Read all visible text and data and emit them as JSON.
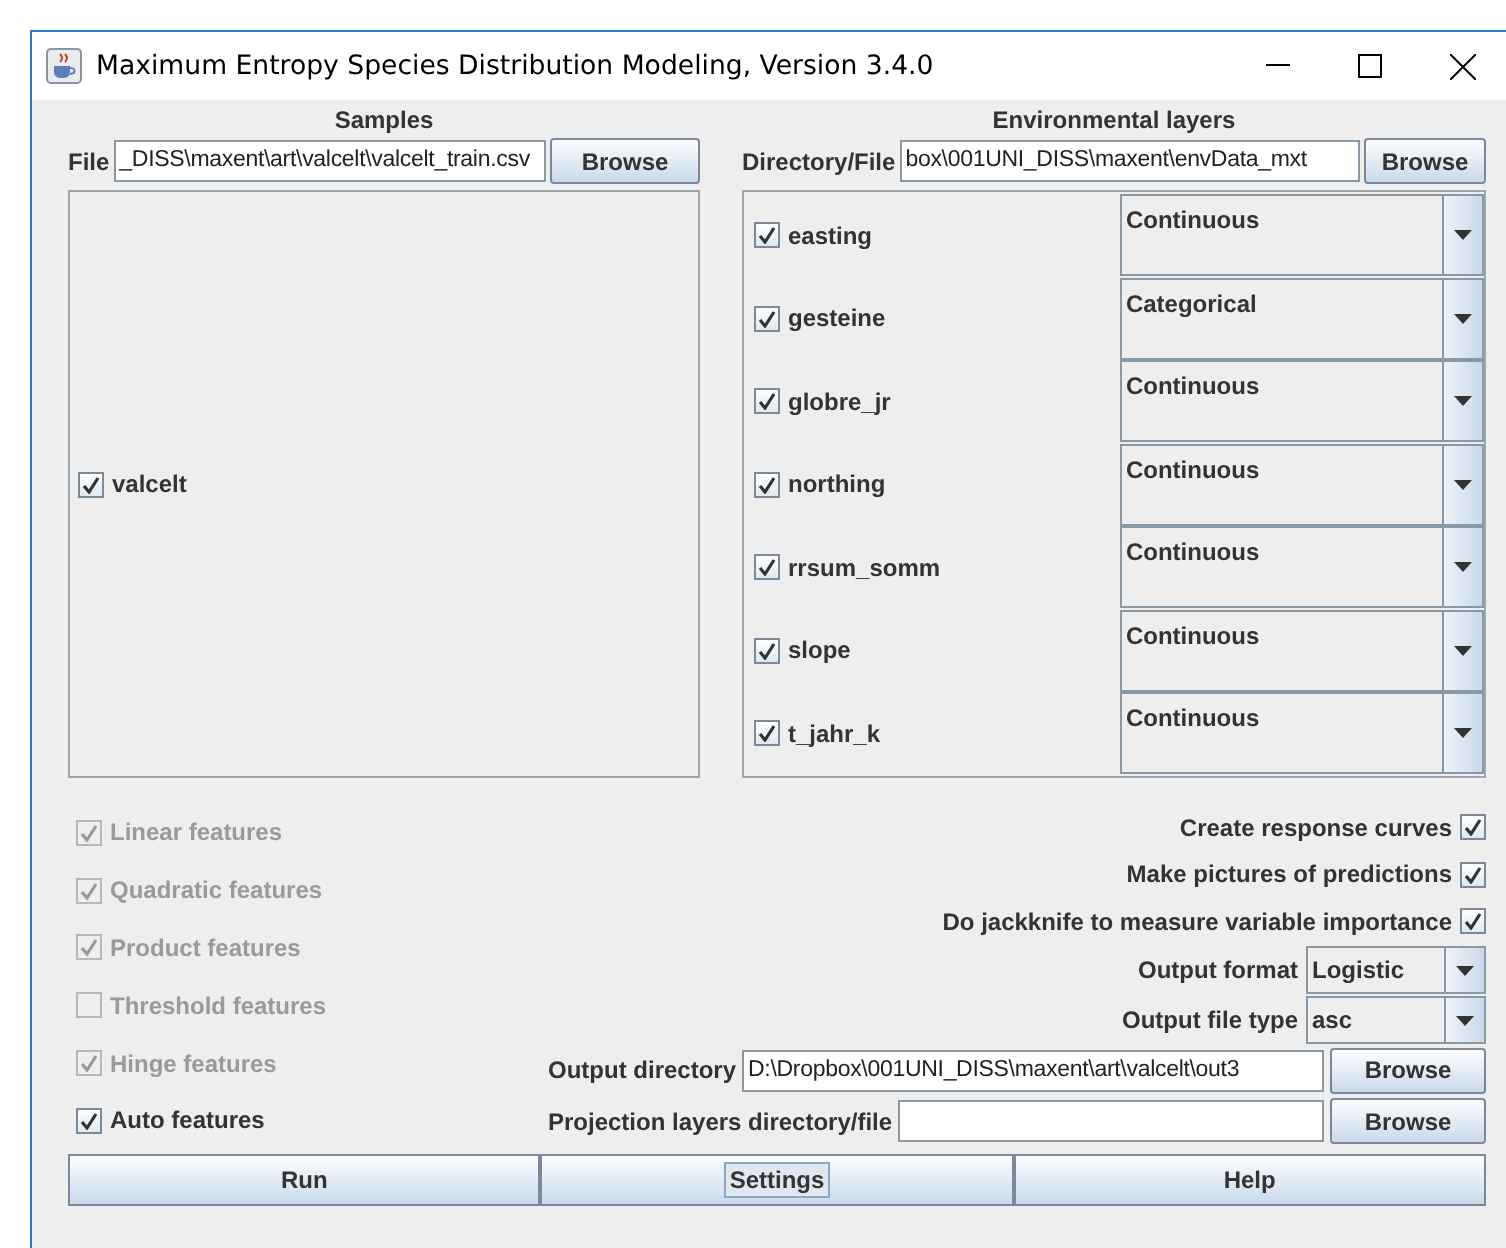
{
  "window": {
    "title": "Maximum Entropy Species Distribution Modeling, Version 3.4.0"
  },
  "samples": {
    "header": "Samples",
    "file_label": "File",
    "file_value": "_DISS\\maxent\\art\\valcelt\\valcelt_train.csv",
    "browse": "Browse",
    "species": [
      {
        "name": "valcelt",
        "checked": true
      }
    ]
  },
  "environmental_layers": {
    "header": "Environmental layers",
    "directory_label": "Directory/File",
    "directory_value": "box\\001UNI_DISS\\maxent\\envData_mxt",
    "browse": "Browse",
    "layers": [
      {
        "name": "easting",
        "checked": true,
        "type": "Continuous"
      },
      {
        "name": "gesteine",
        "checked": true,
        "type": "Categorical"
      },
      {
        "name": "globre_jr",
        "checked": true,
        "type": "Continuous"
      },
      {
        "name": "northing",
        "checked": true,
        "type": "Continuous"
      },
      {
        "name": "rrsum_somm",
        "checked": true,
        "type": "Continuous"
      },
      {
        "name": "slope",
        "checked": true,
        "type": "Continuous"
      },
      {
        "name": "t_jahr_k",
        "checked": true,
        "type": "Continuous"
      }
    ]
  },
  "features": [
    {
      "label": "Linear features",
      "checked": true,
      "disabled": true
    },
    {
      "label": "Quadratic features",
      "checked": true,
      "disabled": true
    },
    {
      "label": "Product features",
      "checked": true,
      "disabled": true
    },
    {
      "label": "Threshold features",
      "checked": false,
      "disabled": true
    },
    {
      "label": "Hinge features",
      "checked": true,
      "disabled": true
    },
    {
      "label": "Auto features",
      "checked": true,
      "disabled": false
    }
  ],
  "options": [
    {
      "label": "Create response curves",
      "checked": true
    },
    {
      "label": "Make pictures of predictions",
      "checked": true
    },
    {
      "label": "Do jackknife to measure variable importance",
      "checked": true
    }
  ],
  "output_format": {
    "label": "Output format",
    "value": "Logistic"
  },
  "output_file_type": {
    "label": "Output file type",
    "value": "asc"
  },
  "output_directory": {
    "label": "Output directory",
    "value": "D:\\Dropbox\\001UNI_DISS\\maxent\\art\\valcelt\\out3",
    "browse": "Browse"
  },
  "projection_layers": {
    "label": "Projection layers directory/file",
    "browse": "Browse"
  },
  "buttons": [
    {
      "label": "Run",
      "focused": false
    },
    {
      "label": "Settings",
      "focused": true
    },
    {
      "label": "Help",
      "focused": false
    }
  ]
}
